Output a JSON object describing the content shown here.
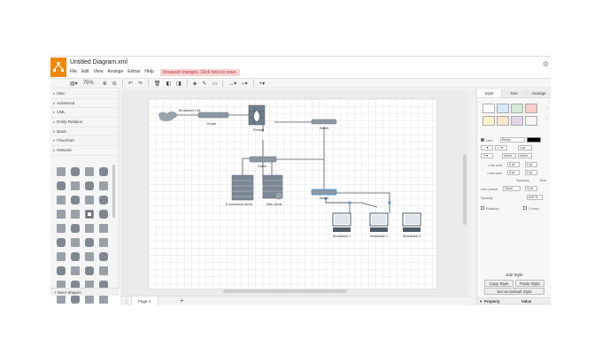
{
  "app": {
    "title": "Untitled Diagram.xml",
    "menu": [
      "File",
      "Edit",
      "View",
      "Arrange",
      "Extras",
      "Help"
    ],
    "unsaved": "Unsaved changes. Click here to save.",
    "accent": "#f08705"
  },
  "toolbar": {
    "zoom": "75%"
  },
  "sidebar": {
    "categories": [
      "Misc",
      "Advanced",
      "UML",
      "Entity Relation",
      "Basic",
      "Flowchart",
      "Network"
    ],
    "more_shapes": "More Shapes"
  },
  "diagram": {
    "labels": {
      "broadband": "Broadband Link",
      "router": "Router",
      "firewall": "Firewall",
      "switch_top": "Switch",
      "switch_mid": "Switch",
      "switch_bottom": "Switch",
      "ecommerce": "E-commerce server",
      "web_server": "Web server",
      "ws1": "Workstation 1",
      "ws2": "Workstation 2",
      "ws3": "Workstation 3"
    }
  },
  "pagebar": {
    "page_tab": "Page-1"
  },
  "panel": {
    "tabs": [
      "Style",
      "Text",
      "Arrange"
    ],
    "swatches": [
      "#ffffff",
      "#dae8fc",
      "#d5e8d4",
      "#f8cecc",
      "#fff2cc",
      "#ffe6cc",
      "#e1d5e7",
      "#f5f5f5"
    ],
    "line_label": "Line",
    "line_style": "Sharp",
    "line_width": "1 pt",
    "none1": "None",
    "none2": "None",
    "line_end_label": "Line end",
    "line_start_label": "Line start",
    "end_val": "0 pt",
    "end_val2": "0 pt",
    "start_val": "0 pt",
    "start_val2": "0 pt",
    "spacing": "Spacing",
    "size": "Size",
    "line_jumps_label": "Line jumps",
    "line_jumps_value": "None",
    "line_jumps_size": "6 pt",
    "opacity_label": "Opacity",
    "opacity_value": "100 %",
    "shadow_label": "Shadow",
    "comic_label": "Comic",
    "edit_style": "Edit Style",
    "copy_style": "Copy Style",
    "paste_style": "Paste Style",
    "set_default": "Set as Default Style",
    "property_header": "Property",
    "value_header": "Value"
  }
}
